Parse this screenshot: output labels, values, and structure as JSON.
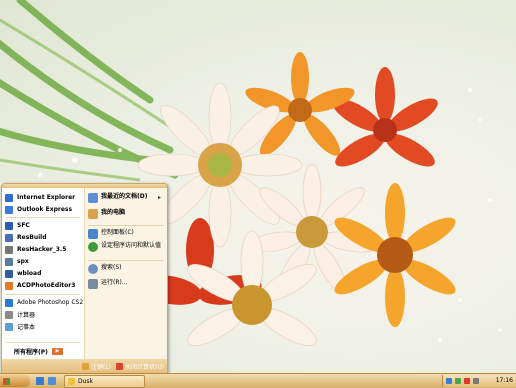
{
  "start_menu": {
    "left_items": [
      {
        "label": "Internet Explorer",
        "icon": "internet-explorer-icon",
        "color": "#2b6fd0"
      },
      {
        "label": "Outlook Express",
        "icon": "outlook-express-icon",
        "color": "#3a7bd5"
      },
      {
        "label": "SFC",
        "icon": "sfc-icon",
        "color": "#2a5fb0"
      },
      {
        "label": "ResBuild",
        "icon": "resbuild-icon",
        "color": "#4a6fb8"
      },
      {
        "label": "ResHacker_3.5",
        "icon": "reshacker-icon",
        "color": "#777777"
      },
      {
        "label": "spx",
        "icon": "spx-icon",
        "color": "#5b7a99"
      },
      {
        "label": "wbload",
        "icon": "wbload-icon",
        "color": "#2f5f9f"
      },
      {
        "label": "ACDPhotoEditor3",
        "icon": "acdphotoeditor-icon",
        "color": "#e07b2a"
      },
      {
        "label": "Adobe Photoshop CS2",
        "icon": "photoshop-icon",
        "color": "#2a7bd0"
      },
      {
        "label": "计算器",
        "icon": "calculator-icon",
        "color": "#8a8a8a"
      },
      {
        "label": "记事本",
        "icon": "notepad-icon",
        "color": "#5a9fd6"
      }
    ],
    "all_programs": "所有程序(P)",
    "right_items": [
      {
        "label": "我最近的文档(D)",
        "icon": "recent-documents-icon",
        "color": "#5a8fd0"
      },
      {
        "label": "我的电脑",
        "icon": "my-computer-icon",
        "color": "#d9a24a"
      },
      {
        "label": "控制面板(C)",
        "icon": "control-panel-icon",
        "color": "#4a87c9"
      },
      {
        "label": "设定程序访问和默认值",
        "icon": "program-access-icon",
        "color": "#3c9a3c"
      },
      {
        "label": "搜索(S)",
        "icon": "search-icon",
        "color": "#6a8fc0"
      },
      {
        "label": "运行(R)...",
        "icon": "run-icon",
        "color": "#7a8aa0"
      }
    ],
    "logoff": "注销(L)",
    "shutdown": "关闭计算机(U)"
  },
  "taskbar": {
    "task_label": "Dusk",
    "clock": "17:16"
  }
}
